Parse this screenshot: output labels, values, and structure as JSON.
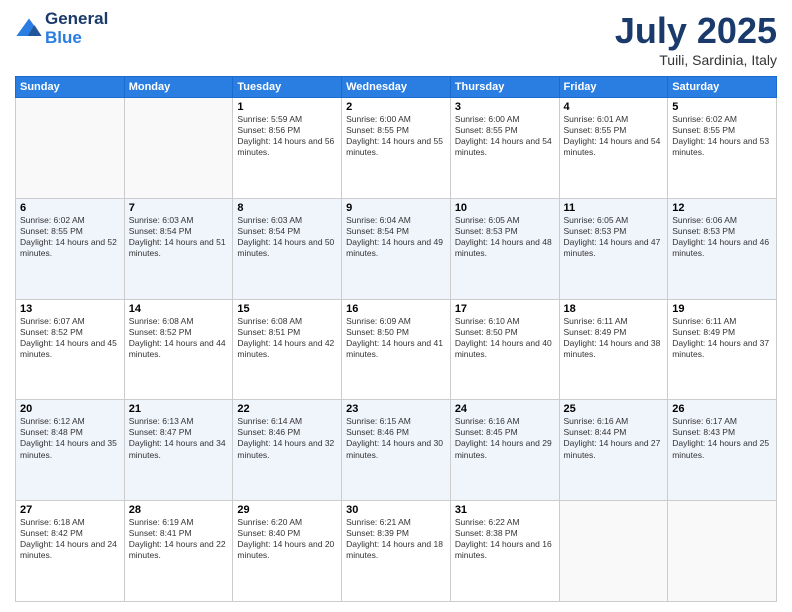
{
  "header": {
    "logo_line1": "General",
    "logo_line2": "Blue",
    "month": "July 2025",
    "location": "Tuili, Sardinia, Italy"
  },
  "days_of_week": [
    "Sunday",
    "Monday",
    "Tuesday",
    "Wednesday",
    "Thursday",
    "Friday",
    "Saturday"
  ],
  "weeks": [
    [
      {
        "day": "",
        "sunrise": "",
        "sunset": "",
        "daylight": "",
        "empty": true
      },
      {
        "day": "",
        "sunrise": "",
        "sunset": "",
        "daylight": "",
        "empty": true
      },
      {
        "day": "1",
        "sunrise": "Sunrise: 5:59 AM",
        "sunset": "Sunset: 8:56 PM",
        "daylight": "Daylight: 14 hours and 56 minutes.",
        "empty": false
      },
      {
        "day": "2",
        "sunrise": "Sunrise: 6:00 AM",
        "sunset": "Sunset: 8:55 PM",
        "daylight": "Daylight: 14 hours and 55 minutes.",
        "empty": false
      },
      {
        "day": "3",
        "sunrise": "Sunrise: 6:00 AM",
        "sunset": "Sunset: 8:55 PM",
        "daylight": "Daylight: 14 hours and 54 minutes.",
        "empty": false
      },
      {
        "day": "4",
        "sunrise": "Sunrise: 6:01 AM",
        "sunset": "Sunset: 8:55 PM",
        "daylight": "Daylight: 14 hours and 54 minutes.",
        "empty": false
      },
      {
        "day": "5",
        "sunrise": "Sunrise: 6:02 AM",
        "sunset": "Sunset: 8:55 PM",
        "daylight": "Daylight: 14 hours and 53 minutes.",
        "empty": false
      }
    ],
    [
      {
        "day": "6",
        "sunrise": "Sunrise: 6:02 AM",
        "sunset": "Sunset: 8:55 PM",
        "daylight": "Daylight: 14 hours and 52 minutes.",
        "empty": false
      },
      {
        "day": "7",
        "sunrise": "Sunrise: 6:03 AM",
        "sunset": "Sunset: 8:54 PM",
        "daylight": "Daylight: 14 hours and 51 minutes.",
        "empty": false
      },
      {
        "day": "8",
        "sunrise": "Sunrise: 6:03 AM",
        "sunset": "Sunset: 8:54 PM",
        "daylight": "Daylight: 14 hours and 50 minutes.",
        "empty": false
      },
      {
        "day": "9",
        "sunrise": "Sunrise: 6:04 AM",
        "sunset": "Sunset: 8:54 PM",
        "daylight": "Daylight: 14 hours and 49 minutes.",
        "empty": false
      },
      {
        "day": "10",
        "sunrise": "Sunrise: 6:05 AM",
        "sunset": "Sunset: 8:53 PM",
        "daylight": "Daylight: 14 hours and 48 minutes.",
        "empty": false
      },
      {
        "day": "11",
        "sunrise": "Sunrise: 6:05 AM",
        "sunset": "Sunset: 8:53 PM",
        "daylight": "Daylight: 14 hours and 47 minutes.",
        "empty": false
      },
      {
        "day": "12",
        "sunrise": "Sunrise: 6:06 AM",
        "sunset": "Sunset: 8:53 PM",
        "daylight": "Daylight: 14 hours and 46 minutes.",
        "empty": false
      }
    ],
    [
      {
        "day": "13",
        "sunrise": "Sunrise: 6:07 AM",
        "sunset": "Sunset: 8:52 PM",
        "daylight": "Daylight: 14 hours and 45 minutes.",
        "empty": false
      },
      {
        "day": "14",
        "sunrise": "Sunrise: 6:08 AM",
        "sunset": "Sunset: 8:52 PM",
        "daylight": "Daylight: 14 hours and 44 minutes.",
        "empty": false
      },
      {
        "day": "15",
        "sunrise": "Sunrise: 6:08 AM",
        "sunset": "Sunset: 8:51 PM",
        "daylight": "Daylight: 14 hours and 42 minutes.",
        "empty": false
      },
      {
        "day": "16",
        "sunrise": "Sunrise: 6:09 AM",
        "sunset": "Sunset: 8:50 PM",
        "daylight": "Daylight: 14 hours and 41 minutes.",
        "empty": false
      },
      {
        "day": "17",
        "sunrise": "Sunrise: 6:10 AM",
        "sunset": "Sunset: 8:50 PM",
        "daylight": "Daylight: 14 hours and 40 minutes.",
        "empty": false
      },
      {
        "day": "18",
        "sunrise": "Sunrise: 6:11 AM",
        "sunset": "Sunset: 8:49 PM",
        "daylight": "Daylight: 14 hours and 38 minutes.",
        "empty": false
      },
      {
        "day": "19",
        "sunrise": "Sunrise: 6:11 AM",
        "sunset": "Sunset: 8:49 PM",
        "daylight": "Daylight: 14 hours and 37 minutes.",
        "empty": false
      }
    ],
    [
      {
        "day": "20",
        "sunrise": "Sunrise: 6:12 AM",
        "sunset": "Sunset: 8:48 PM",
        "daylight": "Daylight: 14 hours and 35 minutes.",
        "empty": false
      },
      {
        "day": "21",
        "sunrise": "Sunrise: 6:13 AM",
        "sunset": "Sunset: 8:47 PM",
        "daylight": "Daylight: 14 hours and 34 minutes.",
        "empty": false
      },
      {
        "day": "22",
        "sunrise": "Sunrise: 6:14 AM",
        "sunset": "Sunset: 8:46 PM",
        "daylight": "Daylight: 14 hours and 32 minutes.",
        "empty": false
      },
      {
        "day": "23",
        "sunrise": "Sunrise: 6:15 AM",
        "sunset": "Sunset: 8:46 PM",
        "daylight": "Daylight: 14 hours and 30 minutes.",
        "empty": false
      },
      {
        "day": "24",
        "sunrise": "Sunrise: 6:16 AM",
        "sunset": "Sunset: 8:45 PM",
        "daylight": "Daylight: 14 hours and 29 minutes.",
        "empty": false
      },
      {
        "day": "25",
        "sunrise": "Sunrise: 6:16 AM",
        "sunset": "Sunset: 8:44 PM",
        "daylight": "Daylight: 14 hours and 27 minutes.",
        "empty": false
      },
      {
        "day": "26",
        "sunrise": "Sunrise: 6:17 AM",
        "sunset": "Sunset: 8:43 PM",
        "daylight": "Daylight: 14 hours and 25 minutes.",
        "empty": false
      }
    ],
    [
      {
        "day": "27",
        "sunrise": "Sunrise: 6:18 AM",
        "sunset": "Sunset: 8:42 PM",
        "daylight": "Daylight: 14 hours and 24 minutes.",
        "empty": false
      },
      {
        "day": "28",
        "sunrise": "Sunrise: 6:19 AM",
        "sunset": "Sunset: 8:41 PM",
        "daylight": "Daylight: 14 hours and 22 minutes.",
        "empty": false
      },
      {
        "day": "29",
        "sunrise": "Sunrise: 6:20 AM",
        "sunset": "Sunset: 8:40 PM",
        "daylight": "Daylight: 14 hours and 20 minutes.",
        "empty": false
      },
      {
        "day": "30",
        "sunrise": "Sunrise: 6:21 AM",
        "sunset": "Sunset: 8:39 PM",
        "daylight": "Daylight: 14 hours and 18 minutes.",
        "empty": false
      },
      {
        "day": "31",
        "sunrise": "Sunrise: 6:22 AM",
        "sunset": "Sunset: 8:38 PM",
        "daylight": "Daylight: 14 hours and 16 minutes.",
        "empty": false
      },
      {
        "day": "",
        "sunrise": "",
        "sunset": "",
        "daylight": "",
        "empty": true
      },
      {
        "day": "",
        "sunrise": "",
        "sunset": "",
        "daylight": "",
        "empty": true
      }
    ]
  ]
}
